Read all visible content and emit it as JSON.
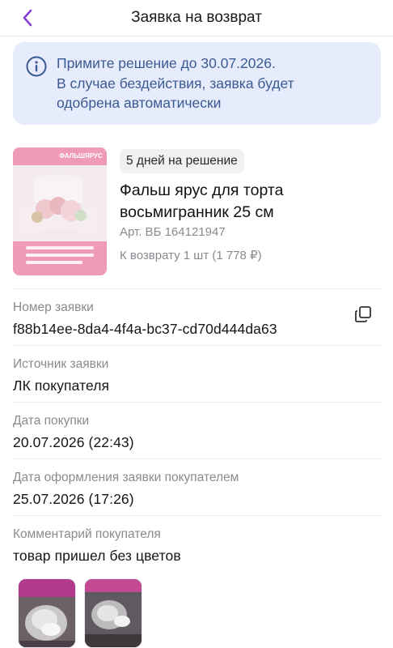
{
  "header": {
    "title": "Заявка на возврат",
    "back_icon": "chevron-left-icon"
  },
  "banner": {
    "icon": "info-icon",
    "lines": [
      "Примите решение до 30.07.2026.",
      "В случае бездействия, заявка будет",
      "одобрена автоматически"
    ]
  },
  "product": {
    "badge": "5 дней на решение",
    "name_lines": [
      "Фальш ярус для торта",
      "восьмигранник 25 см"
    ],
    "article": "Арт. ВБ 164121947",
    "return_info": "К возврату 1 шт (1 778 ₽)",
    "thumbnail_title": "ФАЛЬШЯРУС"
  },
  "fields": [
    {
      "label": "Номер заявки",
      "value": "f88b14ee-8da4-4f4a-bc37-cd70d444da63",
      "action_icon": "copy-icon"
    },
    {
      "label": "Источник заявки",
      "value": "ЛК покупателя"
    },
    {
      "label": "Дата покупки",
      "value": "20.07.2026 (22:43)"
    },
    {
      "label": "Дата оформления заявки покупателем",
      "value": "25.07.2026 (17:26)"
    },
    {
      "label": "Комментарий покупателя",
      "value": "товар пришел без цветов"
    }
  ],
  "photos": [
    "customer-photo-1",
    "customer-photo-2"
  ],
  "colors": {
    "accent": "#8b3fd9",
    "banner_bg": "#e6ecfb",
    "banner_text": "#3b5a93",
    "muted": "#8a8a90"
  }
}
